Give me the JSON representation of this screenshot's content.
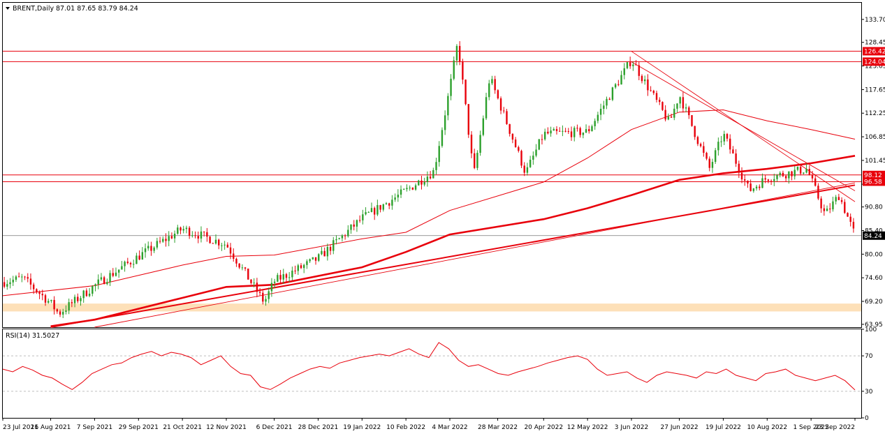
{
  "header": {
    "symbol_label": "BRENT,Daily",
    "ohlc_label": "87.01 87.65 83.79 84.24",
    "indicator_label": "RSI(14) 31.5027"
  },
  "colors": {
    "bull": "#2ca02c",
    "bear": "#e8000b",
    "level_line": "#e8000b",
    "moving_average": "#e8000b",
    "support_zone": "#fde0b8",
    "rsi_line": "#e8000b",
    "last_price_line": "#777777",
    "grid": "#bfbfbf"
  },
  "chart_data": [
    {
      "type": "candlestick",
      "title": "BRENT,Daily",
      "x_tick_labels": [
        "23 Jul 2021",
        "16 Aug 2021",
        "7 Sep 2021",
        "29 Sep 2021",
        "21 Oct 2021",
        "12 Nov 2021",
        "6 Dec 2021",
        "28 Dec 2021",
        "19 Jan 2022",
        "10 Feb 2022",
        "4 Mar 2022",
        "28 Mar 2022",
        "20 Apr 2022",
        "12 May 2022",
        "3 Jun 2022",
        "27 Jun 2022",
        "19 Jul 2022",
        "10 Aug 2022",
        "1 Sep 2022",
        "23 Sep 2022"
      ],
      "y_ticks": [
        63.95,
        69.2,
        74.6,
        80.0,
        85.4,
        90.8,
        96.0,
        101.45,
        106.85,
        112.25,
        117.65,
        123.05,
        128.45,
        133.7
      ],
      "y_tick_labels": [
        "63.95",
        "69.20",
        "74.60",
        "80.00",
        "85.40",
        "90.80",
        "",
        "101.45",
        "106.85",
        "112.25",
        "117.65",
        "123.05",
        "128.45",
        "133.70"
      ],
      "ylim": [
        63.3,
        137.5
      ],
      "horizontal_levels": [
        {
          "value": 126.42,
          "label": "126.42"
        },
        {
          "value": 124.04,
          "label": "124.04"
        },
        {
          "value": 98.12,
          "label": "98.12"
        },
        {
          "value": 96.58,
          "label": "96.58"
        }
      ],
      "last_price": {
        "value": 84.24,
        "label": "84.24"
      },
      "support_zone": {
        "low": 66.9,
        "high": 68.7
      },
      "close_path": [
        {
          "x": "23 Jul 2021",
          "y": 73.6
        },
        {
          "x": "2 Aug 2021",
          "y": 74.5
        },
        {
          "x": "16 Aug 2021",
          "y": 68.8
        },
        {
          "x": "20 Aug 2021",
          "y": 66.4
        },
        {
          "x": "7 Sep 2021",
          "y": 72.8
        },
        {
          "x": "29 Sep 2021",
          "y": 79.5
        },
        {
          "x": "21 Oct 2021",
          "y": 85.8
        },
        {
          "x": "12 Nov 2021",
          "y": 82.2
        },
        {
          "x": "1 Dec 2021",
          "y": 69.0
        },
        {
          "x": "6 Dec 2021",
          "y": 73.8
        },
        {
          "x": "28 Dec 2021",
          "y": 79.0
        },
        {
          "x": "19 Jan 2022",
          "y": 88.2
        },
        {
          "x": "10 Feb 2022",
          "y": 94.5
        },
        {
          "x": "24 Feb 2022",
          "y": 99.0
        },
        {
          "x": "4 Mar 2022",
          "y": 118.0
        },
        {
          "x": "8 Mar 2022",
          "y": 128.5
        },
        {
          "x": "16 Mar 2022",
          "y": 98.0
        },
        {
          "x": "24 Mar 2022",
          "y": 120.5
        },
        {
          "x": "11 Apr 2022",
          "y": 98.5
        },
        {
          "x": "20 Apr 2022",
          "y": 107.5
        },
        {
          "x": "12 May 2022",
          "y": 108.0
        },
        {
          "x": "3 Jun 2022",
          "y": 124.5
        },
        {
          "x": "22 Jun 2022",
          "y": 110.0
        },
        {
          "x": "27 Jun 2022",
          "y": 116.5
        },
        {
          "x": "12 Jul 2022",
          "y": 99.5
        },
        {
          "x": "19 Jul 2022",
          "y": 107.5
        },
        {
          "x": "1 Aug 2022",
          "y": 94.5
        },
        {
          "x": "10 Aug 2022",
          "y": 97.5
        },
        {
          "x": "30 Aug 2022",
          "y": 99.5
        },
        {
          "x": "8 Sep 2022",
          "y": 89.0
        },
        {
          "x": "15 Sep 2022",
          "y": 93.5
        },
        {
          "x": "23 Sep 2022",
          "y": 84.24
        }
      ],
      "moving_averages": [
        {
          "line": "thin",
          "points": [
            {
              "x": "23 Jul 2021",
              "y": 70.5
            },
            {
              "x": "7 Sep 2021",
              "y": 72.8
            },
            {
              "x": "21 Oct 2021",
              "y": 77.5
            },
            {
              "x": "12 Nov 2021",
              "y": 79.5
            },
            {
              "x": "6 Dec 2021",
              "y": 79.8
            },
            {
              "x": "19 Jan 2022",
              "y": 83.5
            },
            {
              "x": "10 Feb 2022",
              "y": 85.0
            },
            {
              "x": "4 Mar 2022",
              "y": 90.0
            },
            {
              "x": "20 Apr 2022",
              "y": 96.5
            },
            {
              "x": "12 May 2022",
              "y": 102.0
            },
            {
              "x": "3 Jun 2022",
              "y": 108.5
            },
            {
              "x": "27 Jun 2022",
              "y": 112.5
            },
            {
              "x": "19 Jul 2022",
              "y": 113.0
            },
            {
              "x": "10 Aug 2022",
              "y": 110.5
            },
            {
              "x": "1 Sep 2022",
              "y": 108.5
            },
            {
              "x": "23 Sep 2022",
              "y": 106.3
            }
          ]
        },
        {
          "line": "thick",
          "points": [
            {
              "x": "16 Aug 2021",
              "y": 63.5
            },
            {
              "x": "7 Sep 2021",
              "y": 65.0
            },
            {
              "x": "21 Oct 2021",
              "y": 70.0
            },
            {
              "x": "12 Nov 2021",
              "y": 72.5
            },
            {
              "x": "6 Dec 2021",
              "y": 73.0
            },
            {
              "x": "19 Jan 2022",
              "y": 77.0
            },
            {
              "x": "10 Feb 2022",
              "y": 80.5
            },
            {
              "x": "4 Mar 2022",
              "y": 84.5
            },
            {
              "x": "20 Apr 2022",
              "y": 88.0
            },
            {
              "x": "12 May 2022",
              "y": 90.5
            },
            {
              "x": "3 Jun 2022",
              "y": 93.5
            },
            {
              "x": "27 Jun 2022",
              "y": 97.0
            },
            {
              "x": "19 Jul 2022",
              "y": 98.5
            },
            {
              "x": "10 Aug 2022",
              "y": 99.5
            },
            {
              "x": "1 Sep 2022",
              "y": 100.8
            },
            {
              "x": "23 Sep 2022",
              "y": 102.5
            }
          ]
        }
      ],
      "trendlines": [
        {
          "from": {
            "x": "16 Aug 2021",
            "y": 63.3
          },
          "to": {
            "x": "23 Sep 2022",
            "y": 95.8
          }
        },
        {
          "from": {
            "x": "7 Sep 2021",
            "y": 63.3
          },
          "to": {
            "x": "23 Sep 2022",
            "y": 96.3
          }
        },
        {
          "from": {
            "x": "3 Jun 2022",
            "y": 126.4
          },
          "to": {
            "x": "23 Sep 2022",
            "y": 92.0
          }
        },
        {
          "from": {
            "x": "3 Jun 2022",
            "y": 124.0
          },
          "to": {
            "x": "23 Sep 2022",
            "y": 94.5
          }
        }
      ]
    },
    {
      "type": "line",
      "title": "RSI(14) 31.5027",
      "ylim": [
        0,
        100
      ],
      "y_ticks": [
        0,
        30,
        70,
        100
      ],
      "y_tick_labels": [
        "0",
        "30",
        "70",
        "100"
      ],
      "reference_levels": [
        30,
        70
      ],
      "series": [
        {
          "values": [
            55,
            52,
            58,
            54,
            48,
            45,
            38,
            32,
            40,
            50,
            55,
            60,
            62,
            68,
            72,
            75,
            70,
            74,
            72,
            68,
            60,
            65,
            70,
            58,
            50,
            48,
            35,
            32,
            38,
            45,
            50,
            55,
            58,
            56,
            62,
            65,
            68,
            70,
            72,
            70,
            74,
            78,
            72,
            68,
            85,
            78,
            65,
            58,
            60,
            55,
            50,
            48,
            52,
            55,
            58,
            62,
            65,
            68,
            70,
            66,
            55,
            48,
            50,
            52,
            45,
            40,
            48,
            52,
            50,
            48,
            45,
            52,
            50,
            55,
            48,
            45,
            42,
            50,
            52,
            55,
            48,
            45,
            42,
            45,
            48,
            42,
            31.5
          ]
        }
      ]
    }
  ]
}
